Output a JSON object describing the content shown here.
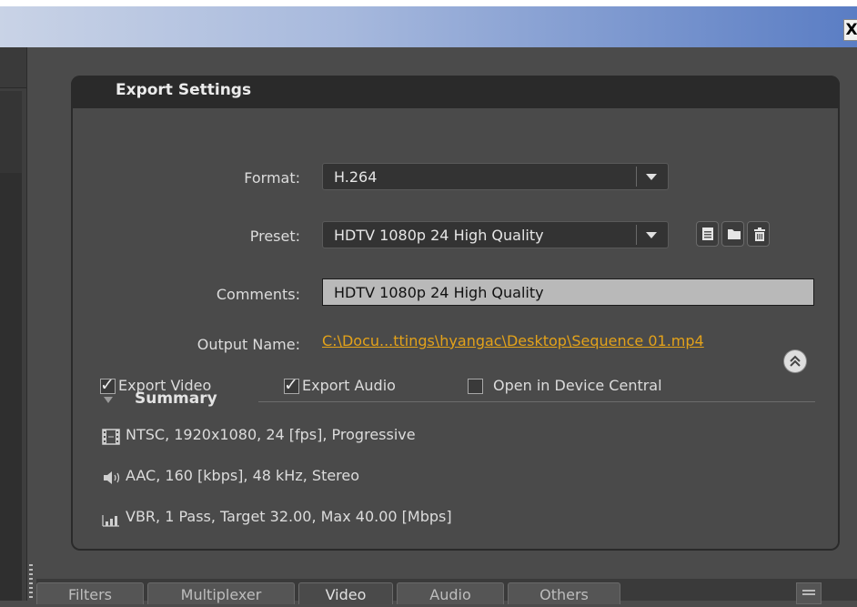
{
  "window": {
    "close_label": "X"
  },
  "panel": {
    "title": "Export Settings"
  },
  "format": {
    "label": "Format:",
    "value": "H.264"
  },
  "preset": {
    "label": "Preset:",
    "value": "HDTV 1080p 24 High Quality",
    "icons": [
      "save-preset-icon",
      "import-preset-icon",
      "delete-preset-icon"
    ]
  },
  "comments": {
    "label": "Comments:",
    "value": "HDTV 1080p 24 High Quality"
  },
  "output": {
    "label": "Output Name:",
    "value": "C:\\Docu...ttings\\hyangac\\Desktop\\Sequence 01.mp4"
  },
  "options": {
    "export_video": {
      "label": "Export Video",
      "checked": true
    },
    "export_audio": {
      "label": "Export Audio",
      "checked": true
    },
    "device_central": {
      "label": "Open in Device Central",
      "checked": false
    }
  },
  "summary": {
    "title": "Summary",
    "video": "NTSC, 1920x1080, 24 [fps], Progressive",
    "audio": "AAC, 160 [kbps], 48 kHz, Stereo",
    "bitrate": "VBR, 1 Pass, Target 32.00, Max 40.00 [Mbps]"
  },
  "tabs": [
    {
      "label": "Filters"
    },
    {
      "label": "Multiplexer"
    },
    {
      "label": "Video"
    },
    {
      "label": "Audio"
    },
    {
      "label": "Others"
    }
  ],
  "colors": {
    "accent_link": "#e3a21a",
    "panel_bg": "#4a4a4a",
    "header_bg": "#2a2a2a"
  }
}
